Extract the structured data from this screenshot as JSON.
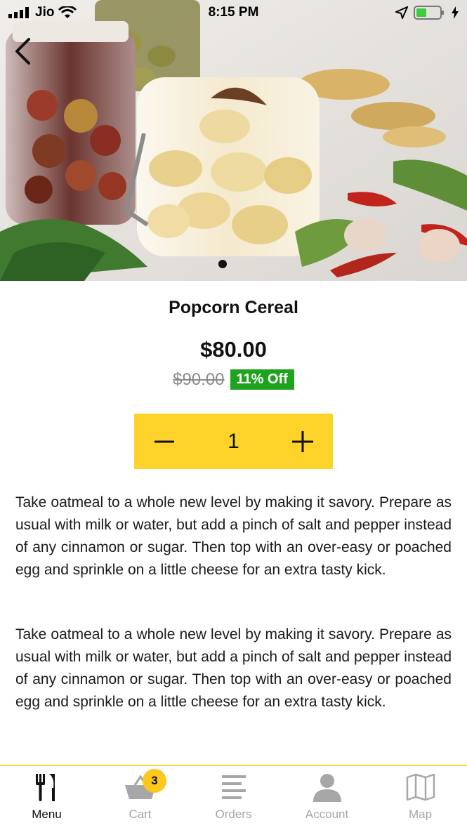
{
  "status_bar": {
    "carrier": "Jio",
    "time": "8:15 PM"
  },
  "product": {
    "title": "Popcorn Cereal",
    "price": "$80.00",
    "original_price": "$90.00",
    "discount": "11% Off",
    "quantity": "1",
    "descriptions": [
      "Take oatmeal to a whole new level by making it savory. Prepare as usual with milk or water, but add a pinch of salt and pepper instead of any cinnamon or sugar. Then top with an over-easy or poached egg and sprinkle on a little cheese for an extra tasty kick.",
      "Take oatmeal to a whole new level by making it savory. Prepare as usual with milk or water, but add a pinch of salt and pepper instead of any cinnamon or sugar. Then top with an over-easy or poached egg and sprinkle on a little cheese for an extra tasty kick."
    ]
  },
  "tabs": [
    {
      "label": "Menu",
      "icon": "fork-knife-icon",
      "active": true
    },
    {
      "label": "Cart",
      "icon": "basket-icon",
      "badge": "3"
    },
    {
      "label": "Orders",
      "icon": "list-icon"
    },
    {
      "label": "Account",
      "icon": "user-icon"
    },
    {
      "label": "Map",
      "icon": "map-icon"
    }
  ],
  "colors": {
    "accent_yellow": "#fdd32a",
    "discount_green": "#1fa31f",
    "inactive_gray": "#a7a7a7"
  }
}
